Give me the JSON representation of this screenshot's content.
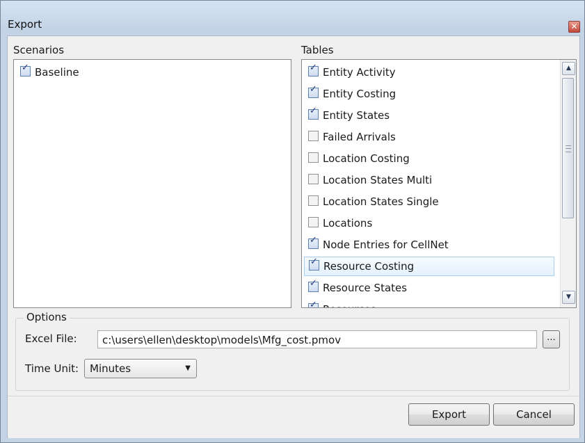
{
  "window": {
    "title": "Export",
    "close_glyph": "✕"
  },
  "scenarios": {
    "label": "Scenarios",
    "items": [
      {
        "label": "Baseline",
        "checked": true
      }
    ]
  },
  "tables": {
    "label": "Tables",
    "items": [
      {
        "label": "Entity Activity",
        "checked": true
      },
      {
        "label": "Entity Costing",
        "checked": true
      },
      {
        "label": "Entity States",
        "checked": true
      },
      {
        "label": "Failed Arrivals",
        "checked": false
      },
      {
        "label": "Location Costing",
        "checked": false
      },
      {
        "label": "Location States Multi",
        "checked": false
      },
      {
        "label": "Location States Single",
        "checked": false
      },
      {
        "label": "Locations",
        "checked": false
      },
      {
        "label": "Node Entries for CellNet",
        "checked": true
      },
      {
        "label": "Resource Costing",
        "checked": true,
        "selected": true
      },
      {
        "label": "Resource States",
        "checked": true
      },
      {
        "label": "Resources",
        "checked": true
      }
    ],
    "scroll_up_icon": "▲",
    "scroll_down_icon": "▼"
  },
  "options": {
    "label": "Options",
    "excel_file_label": "Excel File:",
    "excel_file_value": "c:\\users\\ellen\\desktop\\models\\Mfg_cost.pmov",
    "browse_label": "...",
    "time_unit_label": "Time Unit:",
    "time_unit_value": "Minutes",
    "dropdown_icon": "▼"
  },
  "buttons": {
    "export": "Export",
    "cancel": "Cancel"
  }
}
